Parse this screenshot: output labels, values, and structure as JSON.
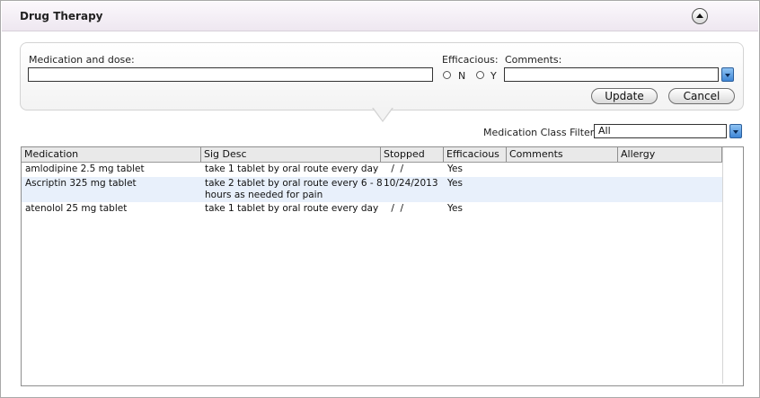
{
  "header": {
    "title": "Drug Therapy"
  },
  "form": {
    "medication_label": "Medication and dose:",
    "medication_value": "",
    "efficacious_label": "Efficacious:",
    "option_n": "N",
    "option_y": "Y",
    "comments_label": "Comments:",
    "comments_value": "",
    "update_label": "Update",
    "cancel_label": "Cancel"
  },
  "filter": {
    "label": "Medication Class Filter:",
    "value": "All"
  },
  "table": {
    "columns": [
      "Medication",
      "Sig Desc",
      "Stopped",
      "Efficacious",
      "Comments",
      "Allergy"
    ],
    "rows": [
      {
        "medication": "amlodipine 2.5 mg tablet",
        "sig_line1": "take 1 tablet by oral route  every day",
        "sig_line2": "",
        "stopped": " /  /",
        "efficacious": "Yes",
        "comments": "",
        "allergy": ""
      },
      {
        "medication": "Ascriptin 325 mg tablet",
        "sig_line1": "take 2 tablet by oral route  every 6 - 8",
        "sig_line2": "hours as needed for pain",
        "stopped": "10/24/2013",
        "efficacious": "Yes",
        "comments": "",
        "allergy": ""
      },
      {
        "medication": "atenolol 25 mg tablet",
        "sig_line1": "take 1 tablet by oral route  every day",
        "sig_line2": "",
        "stopped": " /  /",
        "efficacious": "Yes",
        "comments": "",
        "allergy": ""
      }
    ]
  },
  "colors": {
    "selected_row": "#e8f0fb",
    "header_bg": "#f3eef5",
    "dropdown_accent": "#3f86d6"
  }
}
